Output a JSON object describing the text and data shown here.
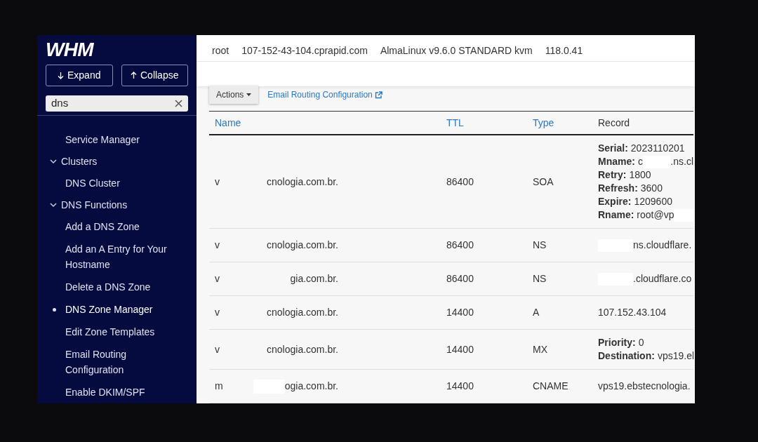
{
  "logo": "WHM",
  "sidebar": {
    "buttons": [
      {
        "label": "Expand"
      },
      {
        "label": "Collapse"
      }
    ],
    "search": {
      "value": "dns"
    },
    "items": [
      {
        "kind": "link",
        "label": "Service Manager",
        "selected": false
      },
      {
        "kind": "group",
        "label": "Clusters",
        "expanded": true,
        "children": [
          {
            "kind": "link",
            "label": "DNS Cluster",
            "selected": false
          }
        ]
      },
      {
        "kind": "group",
        "label": "DNS Functions",
        "expanded": true,
        "children": [
          {
            "kind": "link",
            "label": "Add a DNS Zone",
            "selected": false
          },
          {
            "kind": "link",
            "label": "Add an A Entry for Your Hostname",
            "selected": false
          },
          {
            "kind": "link",
            "label": "Delete a DNS Zone",
            "selected": false
          },
          {
            "kind": "link",
            "label": "DNS Zone Manager",
            "selected": true
          },
          {
            "kind": "link",
            "label": "Edit Zone Templates",
            "selected": false
          },
          {
            "kind": "link",
            "label": "Email Routing Configuration",
            "selected": false
          },
          {
            "kind": "link",
            "label": "Enable DKIM/SPF",
            "selected": false
          }
        ]
      }
    ]
  },
  "header": {
    "values": [
      "root",
      "107-152-43-104.cprapid.com",
      "AlmaLinux v9.6.0 STANDARD kvm",
      "118.0.41"
    ]
  },
  "toolbar": {
    "actions": "Actions",
    "link": "Email Routing Configuration"
  },
  "table": {
    "columns": [
      {
        "label": "Name",
        "sortable": true
      },
      {
        "label": "TTL",
        "sortable": true
      },
      {
        "label": "Type",
        "sortable": true
      },
      {
        "label": "Record",
        "sortable": false
      }
    ],
    "rows": [
      {
        "name_head": "v",
        "name_redacted": false,
        "name_tail": "cnologia.com.br.",
        "ttl": "86400",
        "type": "SOA",
        "record": [
          {
            "label": "Serial:",
            "segments": [
              {
                "kind": "text",
                "text": "2023110201"
              }
            ]
          },
          {
            "label": "Mname:",
            "segments": [
              {
                "kind": "text",
                "text": "c"
              },
              {
                "kind": "redaction"
              },
              {
                "kind": "text",
                "text": ".ns.cl"
              }
            ]
          },
          {
            "label": "Retry:",
            "segments": [
              {
                "kind": "text",
                "text": "1800"
              }
            ]
          },
          {
            "label": "Refresh:",
            "segments": [
              {
                "kind": "text",
                "text": "3600"
              }
            ]
          },
          {
            "label": "Expire:",
            "segments": [
              {
                "kind": "text",
                "text": "1209600"
              }
            ]
          },
          {
            "label": "Rname:",
            "segments": [
              {
                "kind": "text",
                "text": "root@vp"
              },
              {
                "kind": "redaction"
              }
            ]
          }
        ]
      },
      {
        "name_head": "v",
        "name_redacted": false,
        "name_tail": "cnologia.com.br.",
        "ttl": "86400",
        "type": "NS",
        "record": [
          {
            "segments": [
              {
                "kind": "redaction"
              },
              {
                "kind": "text",
                "text": "ns.cloudflare."
              }
            ]
          }
        ]
      },
      {
        "name_head": "v",
        "name_redacted": false,
        "name_tail": "gia.com.br.",
        "ttl": "86400",
        "type": "NS",
        "record": [
          {
            "segments": [
              {
                "kind": "redaction"
              },
              {
                "kind": "text",
                "text": ".cloudflare.co"
              }
            ]
          }
        ]
      },
      {
        "name_head": "v",
        "name_redacted": false,
        "name_tail": "cnologia.com.br.",
        "ttl": "14400",
        "type": "A",
        "record": [
          {
            "segments": [
              {
                "kind": "text",
                "text": "107.152.43.104"
              }
            ]
          }
        ]
      },
      {
        "name_head": "v",
        "name_redacted": false,
        "name_tail": "cnologia.com.br.",
        "ttl": "14400",
        "type": "MX",
        "record": [
          {
            "label": "Priority:",
            "segments": [
              {
                "kind": "text",
                "text": "0"
              }
            ]
          },
          {
            "label": "Destination:",
            "segments": [
              {
                "kind": "text",
                "text": "vps19.el"
              }
            ]
          }
        ]
      },
      {
        "name_head": "m",
        "name_redacted": true,
        "name_tail": "ogia.com.br.",
        "ttl": "14400",
        "type": "CNAME",
        "record": [
          {
            "segments": [
              {
                "kind": "text",
                "text": "vps19.ebstecnologia."
              }
            ]
          }
        ]
      }
    ]
  }
}
